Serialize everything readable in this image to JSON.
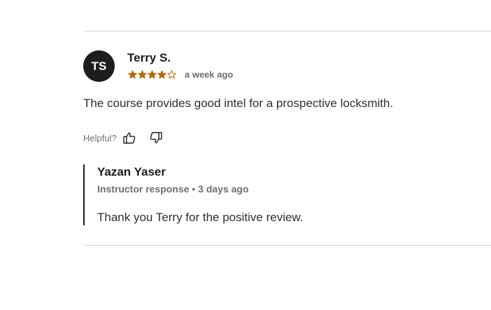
{
  "review": {
    "avatar_initials": "TS",
    "reviewer_name": "Terry S.",
    "rating": 4,
    "rating_max": 5,
    "star_color": "#b4690e",
    "time_ago": "a week ago",
    "text": "The course provides good intel for a prospective locksmith.",
    "helpful_label": "Helpful?",
    "thumbs_up_icon": "thumbs-up-icon",
    "thumbs_down_icon": "thumbs-down-icon"
  },
  "instructor_response": {
    "name": "Yazan Yaser",
    "role": "Instructor response",
    "separator": "•",
    "time_ago": "3 days ago",
    "text": "Thank you Terry for the positive review."
  }
}
